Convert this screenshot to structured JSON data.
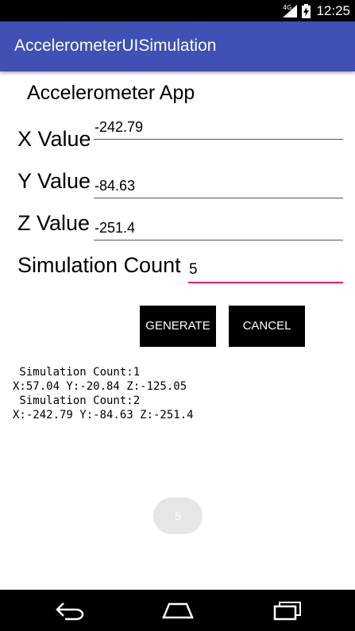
{
  "status_bar": {
    "time": "12:25",
    "network": "4G",
    "icons": [
      "signal-icon",
      "battery-charging-icon"
    ]
  },
  "app_bar": {
    "title": "AccelerometerUISimulation"
  },
  "main": {
    "heading": "Accelerometer App",
    "fields": [
      {
        "label": "X Value",
        "value": "-242.79"
      },
      {
        "label": "Y Value",
        "value": "-84.63"
      },
      {
        "label": "Z Value",
        "value": "-251.4"
      },
      {
        "label": "Simulation Count",
        "value": "5"
      }
    ],
    "buttons": {
      "generate": "GENERATE",
      "cancel": "CANCEL"
    },
    "log_lines": [
      " Simulation Count:1",
      "X:57.04 Y:-20.84 Z:-125.05",
      " Simulation Count:2",
      "X:-242.79 Y:-84.63 Z:-251.4"
    ],
    "toast": "5"
  },
  "nav_bar": {
    "icons": [
      "back-icon",
      "home-icon",
      "recents-icon"
    ]
  },
  "colors": {
    "app_bar": "#3f51b5",
    "focus_underline": "#e91e63",
    "button_bg": "#000000"
  }
}
